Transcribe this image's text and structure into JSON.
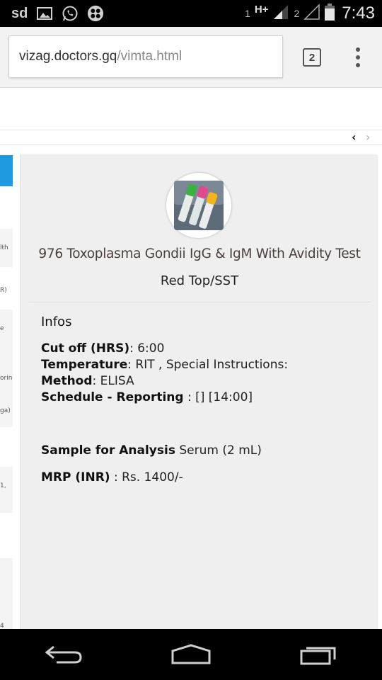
{
  "status_bar": {
    "carrier": "sd",
    "sim1_label": "1",
    "network_type": "H+",
    "sim2_label": "2",
    "time": "7:43"
  },
  "browser": {
    "url_host": "vizag.doctors.gq",
    "url_path": "/vimta.html",
    "tab_count": "2"
  },
  "left_column": {
    "items": [
      "lth",
      "R)",
      "e",
      "orin",
      "ga)",
      "1,",
      "4"
    ]
  },
  "test": {
    "title": "976 Toxoplasma Gondii IgG & IgM With Avidity Test",
    "container": "Red Top/SST",
    "infos_heading": "Infos",
    "cutoff_label": "Cut off (HRS)",
    "cutoff_value": ": 6:00",
    "temperature_label": "Temperature",
    "temperature_value": ": RIT , Special Instructions:",
    "method_label": "Method",
    "method_value": ": ELISA",
    "schedule_label": "Schedule - Reporting",
    "schedule_value": " : [] [14:00]",
    "sample_label": "Sample for Analysis",
    "sample_value": " Serum (2 mL)",
    "mrp_label": "MRP (INR)",
    "mrp_value": " : Rs. 1400/-"
  }
}
